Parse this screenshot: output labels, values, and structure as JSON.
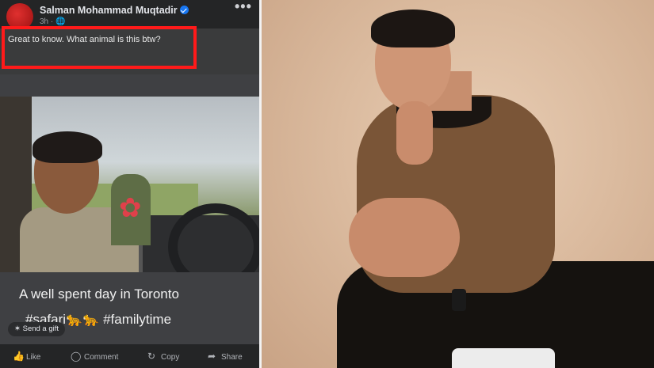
{
  "post": {
    "author": "Salman Mohammad Muqtadir",
    "meta": "3h · 🌐",
    "menu_glyph": "•••",
    "comment": "Great to know. What animal is this btw?"
  },
  "embedded_post": {
    "caption": "A well spent day in Toronto",
    "hashtags": "#safari🐆🐆 #familytime",
    "gift_label": "Send a gift"
  },
  "actions": [
    {
      "label": "Like",
      "icon": "thumbs-up-icon",
      "glyph": "👍"
    },
    {
      "label": "Comment",
      "icon": "comment-icon",
      "glyph": "◯"
    },
    {
      "label": "Copy",
      "icon": "copy-icon",
      "glyph": "↻"
    },
    {
      "label": "Share",
      "icon": "share-icon",
      "glyph": "➦"
    }
  ],
  "colors": {
    "panel_bg": "#242526",
    "highlight_box": "#ff1a1a",
    "verified_badge": "#1877f2",
    "right_bg": "#dbbb9f"
  }
}
